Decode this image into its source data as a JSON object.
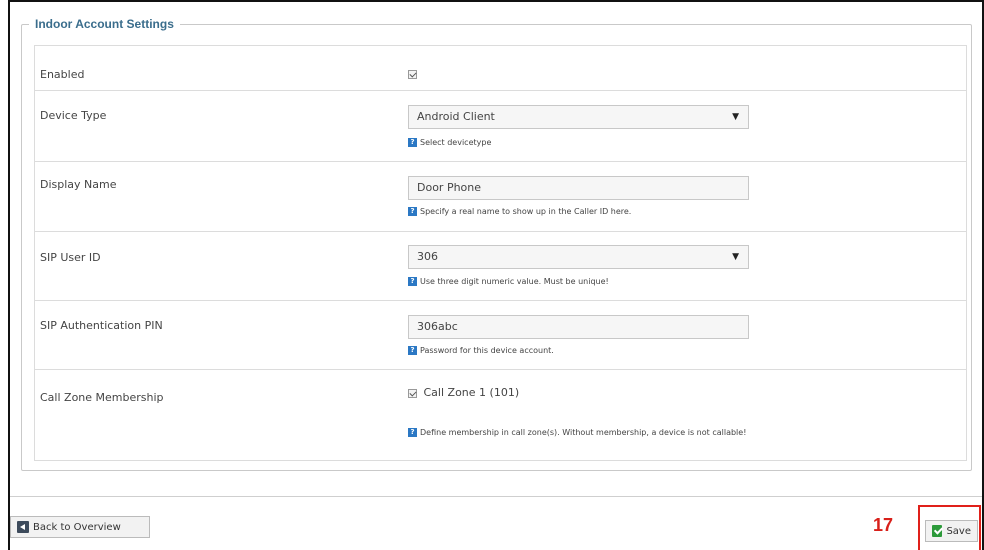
{
  "panel": {
    "legend": "Indoor Account Settings"
  },
  "fields": {
    "enabled": {
      "label": "Enabled",
      "checked": true
    },
    "device_type": {
      "label": "Device Type",
      "value": "Android Client",
      "hint": "Select devicetype"
    },
    "display_name": {
      "label": "Display Name",
      "value": "Door Phone",
      "hint": "Specify a real name to show up in the Caller ID here."
    },
    "sip_user_id": {
      "label": "SIP User ID",
      "value": "306",
      "hint": "Use three digit numeric value. Must be unique!"
    },
    "sip_auth_pin": {
      "label": "SIP Authentication PIN",
      "value": "306abc",
      "hint": "Password for this device account."
    },
    "call_zone": {
      "label": "Call Zone Membership",
      "option_label": "Call Zone 1 (101)",
      "checked": true,
      "hint": "Define membership in call zone(s). Without membership, a device is not callable!"
    }
  },
  "footer": {
    "back_label": "Back to Overview",
    "save_label": "Save"
  },
  "annotation": {
    "step_number": "17",
    "color": "#e0201a"
  }
}
